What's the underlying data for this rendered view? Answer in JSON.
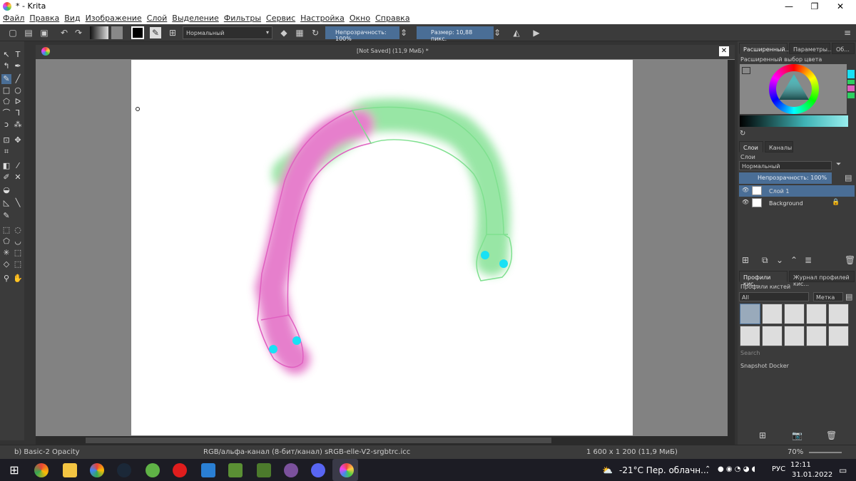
{
  "window": {
    "title": "* - Krita",
    "min": "—",
    "max": "❐",
    "close": "✕"
  },
  "menu": [
    "Файл",
    "Правка",
    "Вид",
    "Изображение",
    "Слой",
    "Выделение",
    "Фильтры",
    "Сервис",
    "Настройка",
    "Окно",
    "Справка"
  ],
  "toolbar": {
    "blend_mode": "Нормальный",
    "opacity": "Непрозрачность: 100%",
    "size": "Размер: 10,88 пикс."
  },
  "document": {
    "tab_title": "[Not Saved]  (11,9 МиБ) *"
  },
  "dock": {
    "tabs_top": [
      "Расширенный...",
      "Параметры...",
      "Об..."
    ],
    "color_selector": "Расширенный выбор цвета",
    "tabs_layers": [
      "Слои",
      "Каналы"
    ],
    "layers_title": "Слои",
    "layer_blend": "Нормальный",
    "layer_opacity": "Непрозрачность:  100%",
    "layers": [
      {
        "name": "Слой 1"
      },
      {
        "name": "Background"
      }
    ],
    "tabs_brush": [
      "Профили кис...",
      "Журнал профилей кис..."
    ],
    "brush_title": "Профили кистей",
    "brush_filter": "All",
    "brush_tag": "Метка",
    "search": "Search",
    "snapshot": "Snapshot Docker"
  },
  "status": {
    "brush": "b) Basic-2 Opacity",
    "colorspace": "RGB/альфа-канал (8-бит/канал)  sRGB-elle-V2-srgbtrc.icc",
    "dimensions": "1 600 x 1 200 (11,9 МиБ)",
    "zoom": "70%"
  },
  "taskbar": {
    "weather": "-21°C  Пер. облачн...",
    "lang": "РУС",
    "time": "12:11",
    "date": "31.01.2022"
  },
  "colors": {
    "pink": "#e060c0",
    "green": "#7fe08f",
    "cyan": "#19e1f5",
    "accent": "#4a6e96"
  }
}
